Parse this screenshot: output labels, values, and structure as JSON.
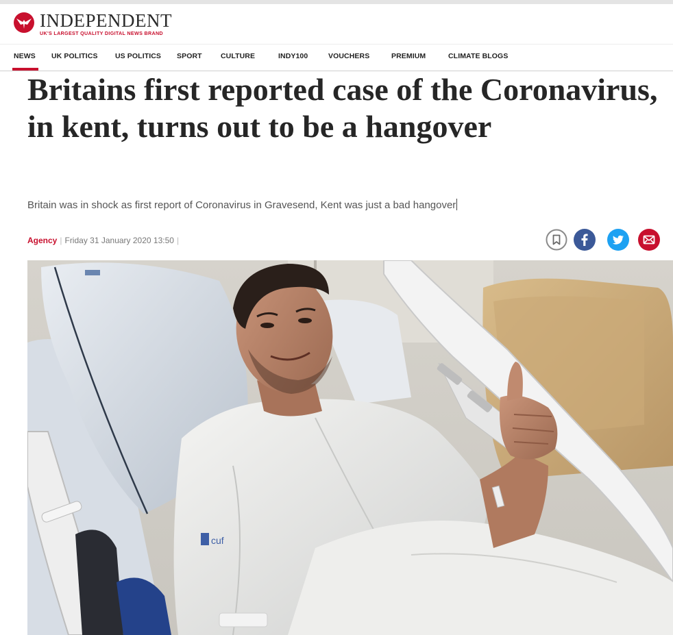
{
  "brand": {
    "name": "INDEPENDENT",
    "tagline": "UK'S LARGEST QUALITY DIGITAL NEWS BRAND",
    "logo_icon": "eagle-icon",
    "accent_color": "#c8102e"
  },
  "nav": {
    "items": [
      {
        "label": "NEWS",
        "active": true
      },
      {
        "label": "UK POLITICS"
      },
      {
        "label": "US POLITICS"
      },
      {
        "label": "SPORT"
      },
      {
        "label": "CULTURE"
      },
      {
        "label": "INDY100"
      },
      {
        "label": "VOUCHERS"
      },
      {
        "label": "PREMIUM"
      },
      {
        "label": "CLIMATE BLOGS"
      }
    ]
  },
  "article": {
    "headline": "Britains first reported case of the Coronavirus, in kent, turns out to be a hangover",
    "standfirst": "Britain was in shock as first report of Coronavirus in Gravesend, Kent was just a bad hangover",
    "author": "Agency",
    "date": "Friday 31 January 2020 13:50",
    "byline_separator": "|",
    "photo_label": "cuf"
  },
  "share": [
    {
      "name": "bookmark-icon",
      "color": "#ffffff",
      "border": "#8a8a8a"
    },
    {
      "name": "facebook-icon",
      "color": "#3b5998"
    },
    {
      "name": "twitter-icon",
      "color": "#1da1f2"
    },
    {
      "name": "email-icon",
      "color": "#c8102e"
    }
  ]
}
